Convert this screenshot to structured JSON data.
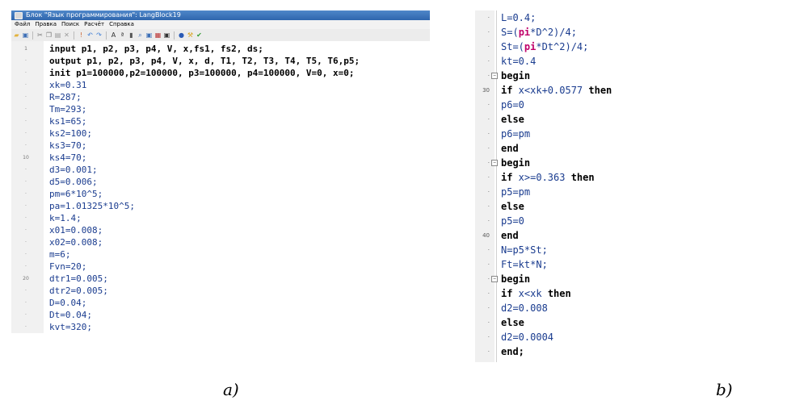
{
  "window": {
    "title": "Блок \"Язык программирования\": LangBlock19",
    "menu": [
      "Файл",
      "Правка",
      "Поиск",
      "Расчёт",
      "Справка"
    ],
    "toolbar_icons": [
      "open-icon",
      "save-icon",
      "cut-icon",
      "copy-icon",
      "paste-icon",
      "delete-icon",
      "run-icon",
      "undo-icon",
      "redo-icon",
      "find-icon",
      "replace-icon",
      "compile-icon",
      "search-icon",
      "view-icon",
      "grid-icon",
      "window-icon",
      "help-icon",
      "tool-icon",
      "check-icon"
    ]
  },
  "panel_a": {
    "lines": [
      {
        "num": "1",
        "text": "input p1, p2, p3, p4, V, x,fs1, fs2, ds;",
        "kw": true
      },
      {
        "num": "·",
        "text": "output p1, p2, p3, p4, V, x, d, T1, T2, T3, T4, T5, T6,p5;",
        "kw": true
      },
      {
        "num": "·",
        "text": "init p1=100000,p2=100000, p3=100000, p4=100000, V=0, x=0;",
        "kw": true
      },
      {
        "num": "·",
        "text": "xk=0.31",
        "kw": false
      },
      {
        "num": "·",
        "text": "R=287;",
        "kw": false
      },
      {
        "num": "·",
        "text": "Tm=293;",
        "kw": false
      },
      {
        "num": "·",
        "text": "ks1=65;",
        "kw": false
      },
      {
        "num": "·",
        "text": "ks2=100;",
        "kw": false
      },
      {
        "num": "·",
        "text": "ks3=70;",
        "kw": false
      },
      {
        "num": "10",
        "text": "ks4=70;",
        "kw": false
      },
      {
        "num": "·",
        "text": "d3=0.001;",
        "kw": false
      },
      {
        "num": "·",
        "text": "d5=0.006;",
        "kw": false
      },
      {
        "num": "·",
        "text": "pm=6*10^5;",
        "kw": false
      },
      {
        "num": "·",
        "text": "pa=1.01325*10^5;",
        "kw": false
      },
      {
        "num": "·",
        "text": "k=1.4;",
        "kw": false
      },
      {
        "num": "·",
        "text": "x01=0.008;",
        "kw": false
      },
      {
        "num": "·",
        "text": "x02=0.008;",
        "kw": false
      },
      {
        "num": "·",
        "text": "m=6;",
        "kw": false
      },
      {
        "num": "·",
        "text": "Fvn=20;",
        "kw": false
      },
      {
        "num": "20",
        "text": "dtr1=0.005;",
        "kw": false
      },
      {
        "num": "·",
        "text": "dtr2=0.005;",
        "kw": false
      },
      {
        "num": "·",
        "text": "D=0.04;",
        "kw": false
      },
      {
        "num": "·",
        "text": "Dt=0.04;",
        "kw": false
      },
      {
        "num": "·",
        "text": "kvt=320;",
        "kw": false
      }
    ]
  },
  "panel_b": {
    "lines": [
      {
        "num": "·",
        "fold": false,
        "parts": [
          [
            "t",
            "L=0.4;"
          ]
        ]
      },
      {
        "num": "·",
        "fold": false,
        "parts": [
          [
            "t",
            "S=("
          ],
          [
            "p",
            "pi"
          ],
          [
            "t",
            "*D^2)/4;"
          ]
        ]
      },
      {
        "num": "·",
        "fold": false,
        "parts": [
          [
            "t",
            "St=("
          ],
          [
            "p",
            "pi"
          ],
          [
            "t",
            "*Dt^2)/4;"
          ]
        ]
      },
      {
        "num": "·",
        "fold": false,
        "parts": [
          [
            "t",
            "kt=0.4"
          ]
        ]
      },
      {
        "num": "·",
        "fold": true,
        "parts": [
          [
            "k",
            "begin"
          ]
        ]
      },
      {
        "num": "30",
        "fold": false,
        "parts": [
          [
            "k",
            "if"
          ],
          [
            "t",
            " x<xk+0.0577 "
          ],
          [
            "k",
            "then"
          ]
        ]
      },
      {
        "num": "·",
        "fold": false,
        "parts": [
          [
            "t",
            "p6=0"
          ]
        ]
      },
      {
        "num": "·",
        "fold": false,
        "parts": [
          [
            "k",
            "else"
          ]
        ]
      },
      {
        "num": "·",
        "fold": false,
        "parts": [
          [
            "t",
            "p6=pm"
          ]
        ]
      },
      {
        "num": "·",
        "fold": false,
        "parts": [
          [
            "k",
            "end"
          ]
        ]
      },
      {
        "num": "·",
        "fold": true,
        "parts": [
          [
            "k",
            "begin"
          ]
        ]
      },
      {
        "num": "·",
        "fold": false,
        "parts": [
          [
            "k",
            "if"
          ],
          [
            "t",
            " x>=0.363 "
          ],
          [
            "k",
            "then"
          ]
        ]
      },
      {
        "num": "·",
        "fold": false,
        "parts": [
          [
            "t",
            "p5=pm"
          ]
        ]
      },
      {
        "num": "·",
        "fold": false,
        "parts": [
          [
            "k",
            "else"
          ]
        ]
      },
      {
        "num": "·",
        "fold": false,
        "parts": [
          [
            "t",
            "p5=0"
          ]
        ]
      },
      {
        "num": "40",
        "fold": false,
        "parts": [
          [
            "k",
            "end"
          ]
        ]
      },
      {
        "num": "·",
        "fold": false,
        "parts": [
          [
            "t",
            "N=p5*St;"
          ]
        ]
      },
      {
        "num": "·",
        "fold": false,
        "parts": [
          [
            "t",
            "Ft=kt*N;"
          ]
        ]
      },
      {
        "num": "·",
        "fold": true,
        "parts": [
          [
            "k",
            "begin"
          ]
        ]
      },
      {
        "num": "·",
        "fold": false,
        "parts": [
          [
            "k",
            "if"
          ],
          [
            "t",
            " x<xk "
          ],
          [
            "k",
            "then"
          ]
        ]
      },
      {
        "num": "·",
        "fold": false,
        "parts": [
          [
            "t",
            "d2=0.008"
          ]
        ]
      },
      {
        "num": "·",
        "fold": false,
        "parts": [
          [
            "k",
            "else"
          ]
        ]
      },
      {
        "num": "·",
        "fold": false,
        "parts": [
          [
            "t",
            "d2=0.0004"
          ]
        ]
      },
      {
        "num": "·",
        "fold": false,
        "parts": [
          [
            "k",
            "end;"
          ]
        ]
      }
    ]
  },
  "captions": {
    "a": "a)",
    "b": "b)"
  }
}
